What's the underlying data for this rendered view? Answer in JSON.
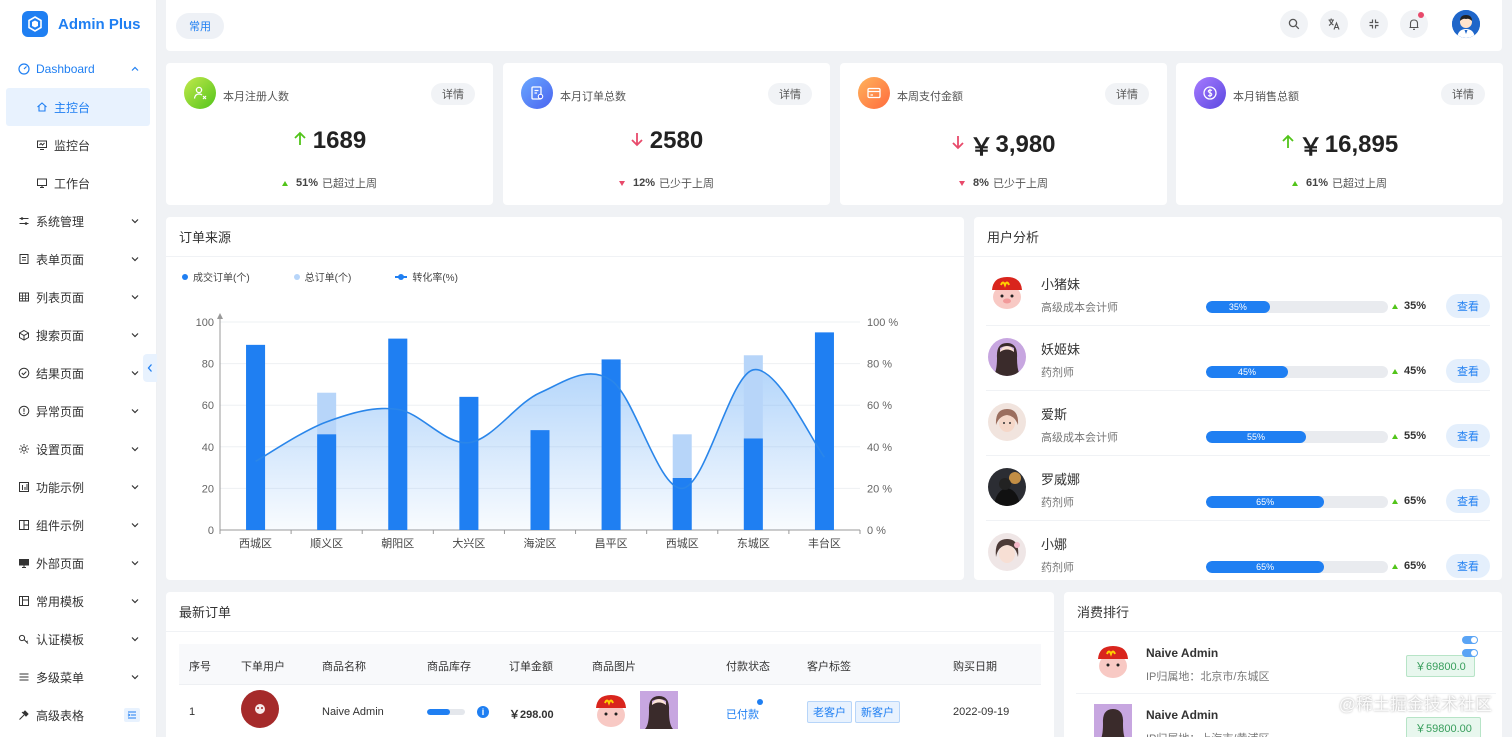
{
  "app": {
    "name": "Admin Plus"
  },
  "sidebar": {
    "dashboard": "Dashboard",
    "sub": [
      "主控台",
      "监控台",
      "工作台"
    ],
    "items": [
      "系统管理",
      "表单页面",
      "列表页面",
      "搜索页面",
      "结果页面",
      "异常页面",
      "设置页面",
      "功能示例",
      "组件示例",
      "外部页面",
      "常用模板",
      "认证模板",
      "多级菜单",
      "高级表格"
    ]
  },
  "header": {
    "tag": "常用"
  },
  "stats": [
    {
      "title": "本月注册人数",
      "detail": "详情",
      "currency": "",
      "value": "1689",
      "direction": "up",
      "pct": "51%",
      "compare": "已超过上周",
      "icon": "user-plus-icon"
    },
    {
      "title": "本月订单总数",
      "detail": "详情",
      "currency": "",
      "value": "2580",
      "direction": "down",
      "pct": "12%",
      "compare": "已少于上周",
      "icon": "order-icon"
    },
    {
      "title": "本周支付金额",
      "detail": "详情",
      "currency": "￥",
      "value": "3,980",
      "direction": "down",
      "pct": "8%",
      "compare": "已少于上周",
      "icon": "payment-card-icon"
    },
    {
      "title": "本月销售总额",
      "detail": "详情",
      "currency": "￥",
      "value": "16,895",
      "direction": "up",
      "pct": "61%",
      "compare": "已超过上周",
      "icon": "dollar-icon"
    }
  ],
  "order_source": {
    "title": "订单来源",
    "legend": [
      "成交订单(个)",
      "总订单(个)",
      "转化率(%)"
    ]
  },
  "chart_data": {
    "type": "bar",
    "categories": [
      "西城区",
      "顺义区",
      "朝阳区",
      "大兴区",
      "海淀区",
      "昌平区",
      "西城区",
      "东城区",
      "丰台区"
    ],
    "series": [
      {
        "name": "成交订单(个)",
        "type": "bar",
        "values": [
          89,
          46,
          92,
          64,
          48,
          82,
          25,
          44,
          95
        ]
      },
      {
        "name": "总订单(个)",
        "type": "bar",
        "values": [
          89,
          66,
          92,
          64,
          48,
          82,
          46,
          84,
          95
        ]
      },
      {
        "name": "转化率(%)",
        "type": "line",
        "axis": "right",
        "values": [
          33,
          52,
          58,
          42,
          66,
          72,
          20,
          77,
          35
        ]
      }
    ],
    "yticks": [
      "0",
      "20",
      "40",
      "60",
      "80",
      "100"
    ],
    "y2ticks": [
      "0 %",
      "20 %",
      "40 %",
      "60 %",
      "80 %",
      "100 %"
    ],
    "ylim": [
      0,
      100
    ],
    "y2lim": [
      0,
      100
    ],
    "grid": true,
    "legend_position": "top-left"
  },
  "user_analysis": {
    "title": "用户分析",
    "button": "查看",
    "users": [
      {
        "name": "小猪妹",
        "role": "高级成本会计师",
        "progress": "35%",
        "pct": 35,
        "trend": "35%"
      },
      {
        "name": "妖姬妹",
        "role": "药剂师",
        "progress": "45%",
        "pct": 45,
        "trend": "45%"
      },
      {
        "name": "爱斯",
        "role": "高级成本会计师",
        "progress": "55%",
        "pct": 55,
        "trend": "55%"
      },
      {
        "name": "罗威娜",
        "role": "药剂师",
        "progress": "65%",
        "pct": 65,
        "trend": "65%"
      },
      {
        "name": "小娜",
        "role": "药剂师",
        "progress": "65%",
        "pct": 65,
        "trend": "65%"
      }
    ]
  },
  "orders": {
    "title": "最新订单",
    "columns": [
      "序号",
      "下单用户",
      "商品名称",
      "商品库存",
      "订单金额",
      "商品图片",
      "付款状态",
      "客户标签",
      "购买日期"
    ],
    "rows": [
      {
        "index": "1",
        "product": "Naive Admin",
        "stock_pct": 60,
        "amount": "￥298.00",
        "status": "已付款",
        "tags": [
          "老客户",
          "新客户"
        ],
        "date": "2022-09-19"
      }
    ]
  },
  "ranking": {
    "title": "消费排行",
    "rows": [
      {
        "name": "Naive Admin",
        "ip": "IP归属地：北京市/东城区",
        "amount": "￥69800.0"
      },
      {
        "name": "Naive Admin",
        "ip": "IP归属地：上海市/黄浦区",
        "amount": "￥59800.00"
      }
    ]
  },
  "watermark": "@稀土掘金技术社区",
  "colors": {
    "primary": "#1f7ff2",
    "up": "#52c41a",
    "down": "#e84a6b"
  }
}
